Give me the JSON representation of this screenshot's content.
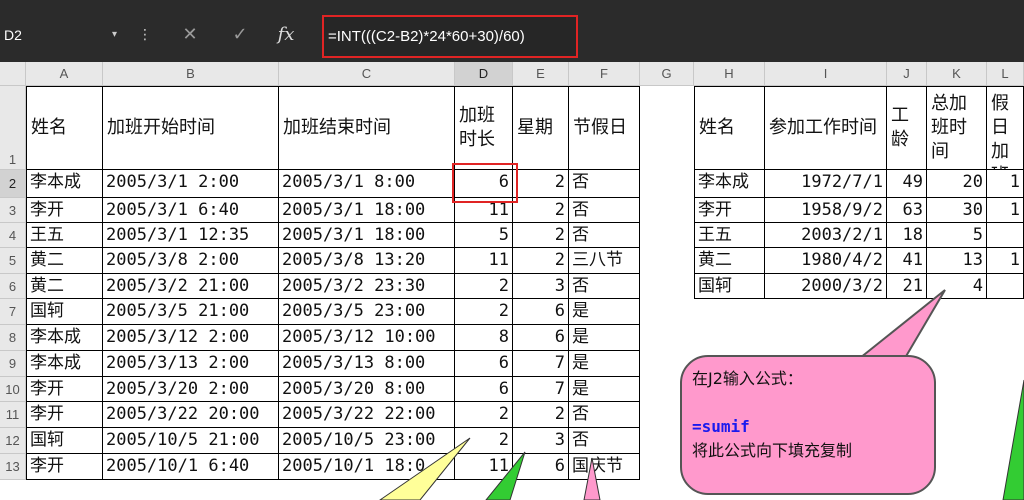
{
  "formula_bar": {
    "name_box": "D2",
    "cancel_icon": "✕",
    "enter_icon": "✓",
    "fx_label": "fx",
    "formula": "=INT(((C2-B2)*24*60+30)/60)"
  },
  "columns": [
    "A",
    "B",
    "C",
    "D",
    "E",
    "F",
    "G",
    "H",
    "I",
    "J",
    "K",
    "L"
  ],
  "rows": [
    "1",
    "2",
    "3",
    "4",
    "5",
    "6",
    "7",
    "8",
    "9",
    "10",
    "11",
    "12",
    "13"
  ],
  "main_table": {
    "headers": [
      "姓名",
      "加班开始时间",
      "加班结束时间",
      "加班时长",
      "星期",
      "节假日"
    ],
    "rows": [
      [
        "李本成",
        "2005/3/1  2:00",
        "2005/3/1  8:00",
        "6",
        "2",
        "否"
      ],
      [
        "李开",
        "2005/3/1  6:40",
        "2005/3/1  18:00",
        "11",
        "2",
        "否"
      ],
      [
        "王五",
        "2005/3/1  12:35",
        "2005/3/1  18:00",
        "5",
        "2",
        "否"
      ],
      [
        "黄二",
        "2005/3/8  2:00",
        "2005/3/8  13:20",
        "11",
        "2",
        "三八节"
      ],
      [
        "黄二",
        "2005/3/2  21:00",
        "2005/3/2  23:30",
        "2",
        "3",
        "否"
      ],
      [
        "国轲",
        "2005/3/5  21:00",
        "2005/3/5  23:00",
        "2",
        "6",
        "是"
      ],
      [
        "李本成",
        "2005/3/12  2:00",
        "2005/3/12  10:00",
        "8",
        "6",
        "是"
      ],
      [
        "李本成",
        "2005/3/13  2:00",
        "2005/3/13  8:00",
        "6",
        "7",
        "是"
      ],
      [
        "李开",
        "2005/3/20  2:00",
        "2005/3/20  8:00",
        "6",
        "7",
        "是"
      ],
      [
        "李开",
        "2005/3/22  20:00",
        "2005/3/22  22:00",
        "2",
        "2",
        "否"
      ],
      [
        "国轲",
        "2005/10/5  21:00",
        "2005/10/5  23:00",
        "2",
        "3",
        "否"
      ],
      [
        "李开",
        "2005/10/1  6:40",
        "2005/10/1  18:0",
        "11",
        "6",
        "国庆节"
      ]
    ]
  },
  "side_table": {
    "headers": [
      "姓名",
      "参加工作时间",
      "工龄",
      "总加班时间",
      "节假日加班"
    ],
    "rows": [
      [
        "李本成",
        "1972/7/1",
        "49",
        "20",
        "1"
      ],
      [
        "李开",
        "1958/9/2",
        "63",
        "30",
        "1"
      ],
      [
        "王五",
        "2003/2/1",
        "18",
        "5",
        ""
      ],
      [
        "黄二",
        "1980/4/2",
        "41",
        "13",
        "1"
      ],
      [
        "国轲",
        "2000/3/2",
        "21",
        "4",
        ""
      ]
    ]
  },
  "callout": {
    "line1": "在J2输入公式：",
    "line2": "=sumif",
    "line3": "将此公式向下填充复制"
  },
  "colors": {
    "highlight": "#e02424",
    "callout": "#ff99cc",
    "arrow_yellow": "#ffff99",
    "arrow_green": "#33cc33"
  }
}
